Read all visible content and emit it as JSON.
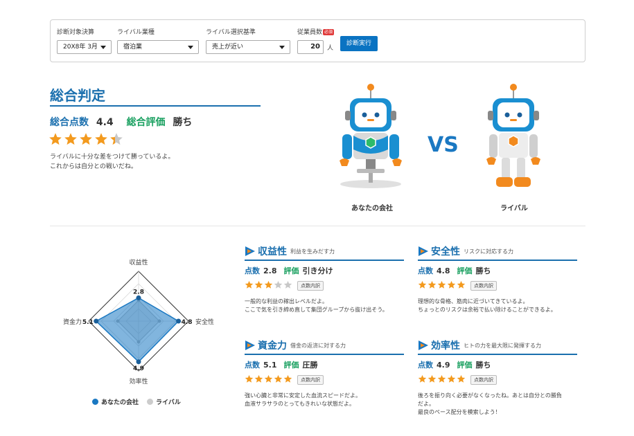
{
  "filters": {
    "period_label": "診断対象決算",
    "period_value": "20X8年 3月",
    "industry_label": "ライバル業種",
    "industry_value": "宿泊業",
    "criteria_label": "ライバル選択基準",
    "criteria_value": "売上が近い",
    "employees_label": "従業員数",
    "required_badge": "必須",
    "employees_value": "20",
    "employees_unit": "人",
    "run_button": "診断実行"
  },
  "overall": {
    "title": "総合判定",
    "score_label": "総合点数",
    "score_value": "4.4",
    "rating_label": "総合評価",
    "rating_value": "勝ち",
    "stars": 4.4,
    "comment_line1": "ライバルに十分な差をつけて勝っているよ。",
    "comment_line2": "これからは自分との戦いだね。"
  },
  "versus": {
    "vs_label": "VS",
    "you_label": "あなたの会社",
    "rival_label": "ライバル"
  },
  "radar": {
    "axes": [
      {
        "label": "収益性",
        "you": 2.8,
        "rival": 2.5
      },
      {
        "label": "安全性",
        "you": 4.8,
        "rival": 2.5
      },
      {
        "label": "効率性",
        "you": 4.9,
        "rival": 2.5
      },
      {
        "label": "資金力",
        "you": 5.1,
        "rival": 2.5
      }
    ],
    "max": 6,
    "you_value_labels": [
      "2.8",
      "4.8",
      "4.9",
      "5.1"
    ],
    "legend_you": "あなたの会社",
    "legend_rival": "ライバル",
    "color_you": "#1a78c2",
    "color_rival": "#cccccc"
  },
  "metrics": [
    {
      "title": "収益性",
      "subtitle": "利益を生みだす力",
      "score_label": "点数",
      "score_value": "2.8",
      "rating_label": "評価",
      "rating_value": "引き分け",
      "stars": 3,
      "detail_button": "点数内訳",
      "comment": [
        "一般的な利益の稼出レベルだよ。",
        "ここで気を引き締め直して集団グループから抜け出そう。"
      ]
    },
    {
      "title": "安全性",
      "subtitle": "リスクに対応する力",
      "score_label": "点数",
      "score_value": "4.8",
      "rating_label": "評価",
      "rating_value": "勝ち",
      "stars": 5,
      "detail_button": "点数内訳",
      "comment": [
        "理想的な骨格、筋肉に近づいてきているよ。",
        "ちょっとのリスクは余裕で払い除けることができるよ。"
      ]
    },
    {
      "title": "資金力",
      "subtitle": "借金の返済に対する力",
      "score_label": "点数",
      "score_value": "5.1",
      "rating_label": "評価",
      "rating_value": "圧勝",
      "stars": 5,
      "detail_button": "点数内訳",
      "comment": [
        "強い心臓と非常に安定した血流スピードだよ。",
        "血液サラサラのとってもきれいな状態だよ。"
      ]
    },
    {
      "title": "効率性",
      "subtitle": "ヒトの力を最大限に発揮する力",
      "score_label": "点数",
      "score_value": "4.9",
      "rating_label": "評価",
      "rating_value": "勝ち",
      "stars": 5,
      "detail_button": "点数内訳",
      "comment": [
        "後ろを振り向く必要がなくなったね。あとは自分との勝負",
        "だよ。",
        "最良のペース配分を模索しよう！"
      ]
    }
  ],
  "colors": {
    "accent_blue": "#1a6fae",
    "accent_green": "#1aa060",
    "star_orange": "#f39a1e",
    "star_gray": "#c8c8c8",
    "button_blue": "#0a73c2"
  }
}
